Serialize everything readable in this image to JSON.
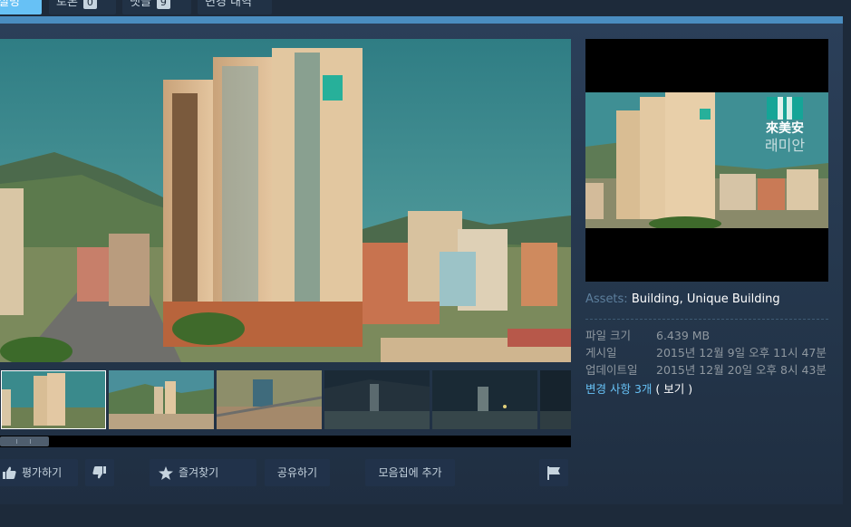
{
  "tabs": [
    {
      "label": "설명",
      "count": "",
      "active": true
    },
    {
      "label": "토론",
      "count": "0",
      "active": false
    },
    {
      "label": "댓글",
      "count": "9",
      "active": false
    },
    {
      "label": "변경 내역",
      "count": "",
      "active": false
    }
  ],
  "preview_sign": {
    "hanja": "來美安",
    "hangul": "래미안"
  },
  "actions": {
    "rate": "평가하기",
    "favorite": "즐겨찾기",
    "share": "공유하기",
    "add_to_collection": "모음집에 추가"
  },
  "tags": {
    "label": "Assets:",
    "items": [
      "Building",
      "Unique Building"
    ],
    "separator": ","
  },
  "details": {
    "file_size_label": "파일 크기",
    "file_size": "6.439 MB",
    "posted_label": "게시일",
    "posted": "2015년 12월 9일 오후 11시 47분",
    "updated_label": "업데이트일",
    "updated": "2015년 12월 20일 오후 8시 43분"
  },
  "change_notes": {
    "link": "변경 사항 3개",
    "view": "( 보기 )"
  }
}
